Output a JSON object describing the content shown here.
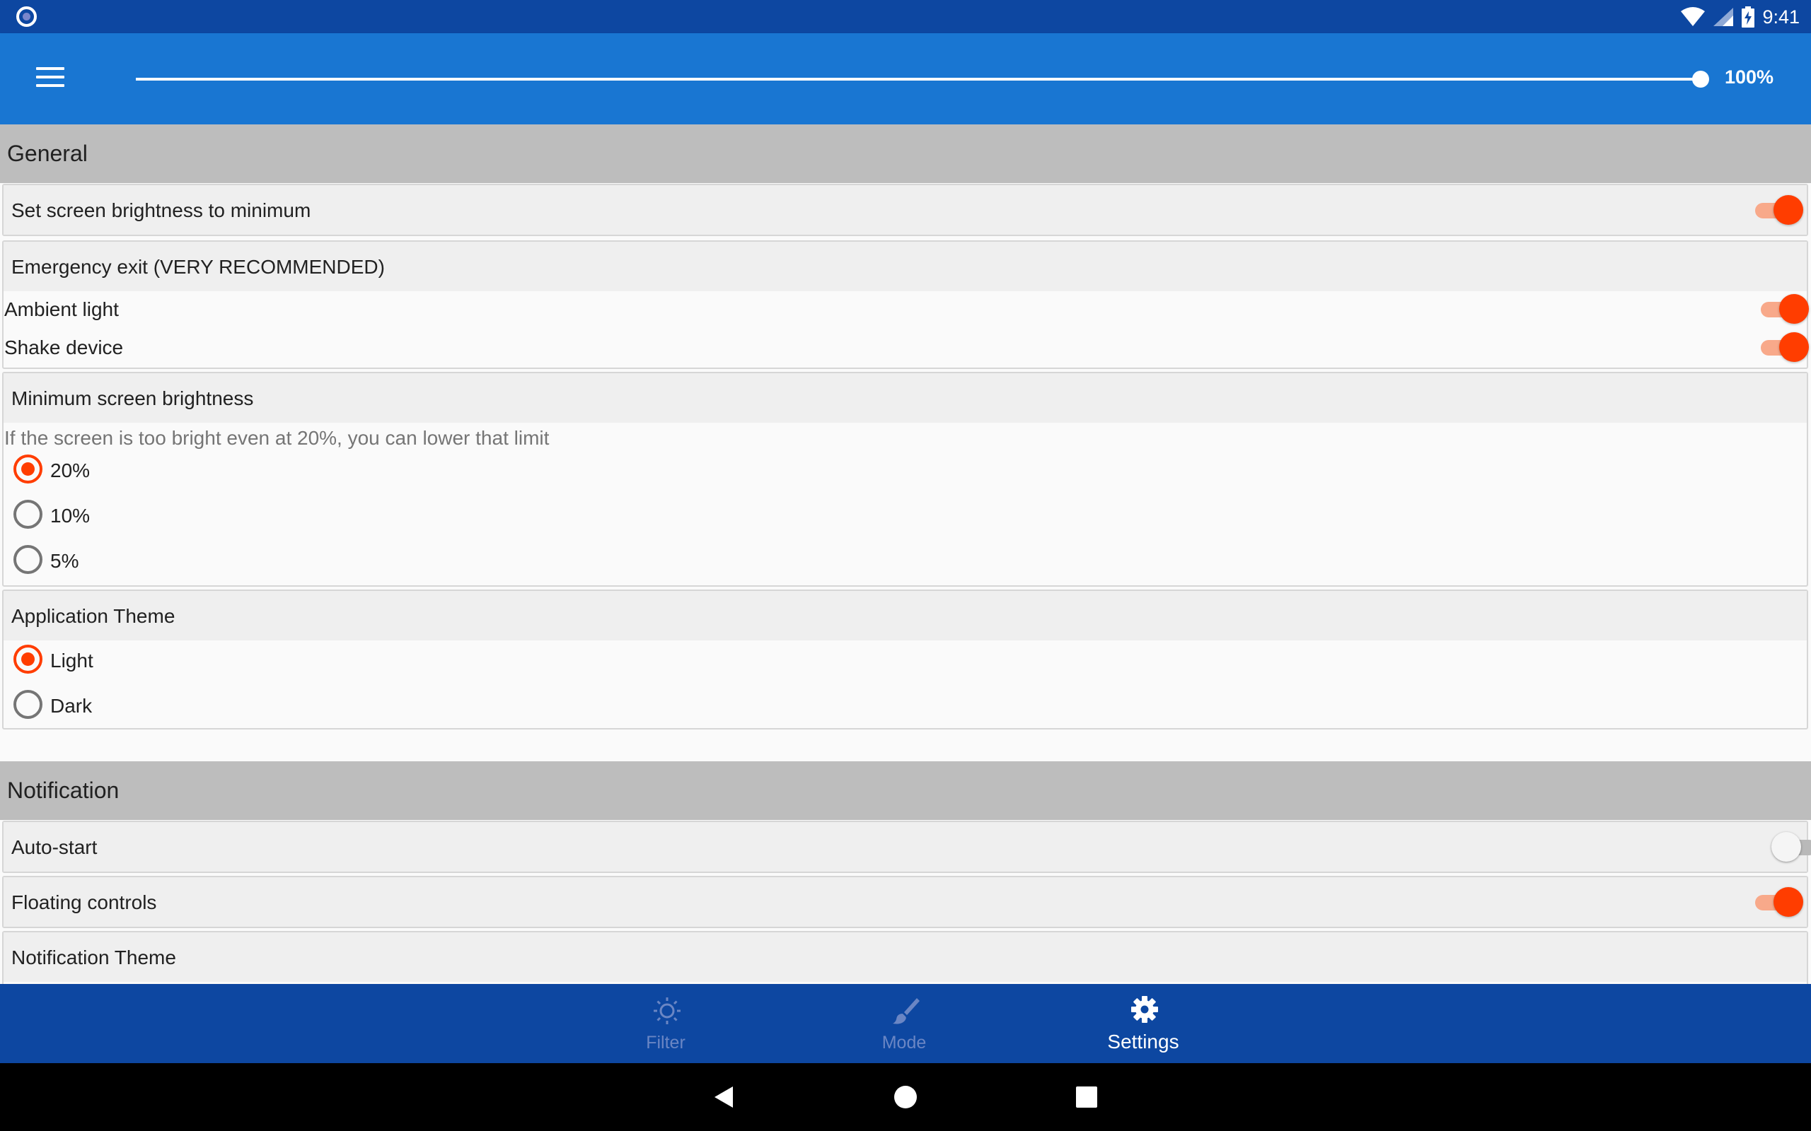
{
  "status_bar": {
    "time": "9:41"
  },
  "app_bar": {
    "slider_value_label": "100%",
    "slider_level": 1.0
  },
  "sections": {
    "general": {
      "title": "General"
    },
    "notification": {
      "title": "Notification"
    }
  },
  "settings": {
    "min_brightness": {
      "label": "Set screen brightness to minimum",
      "enabled": true
    },
    "emergency_exit": {
      "title": "Emergency exit (VERY RECOMMENDED)",
      "ambient_light": {
        "label": "Ambient light",
        "enabled": true
      },
      "shake_device": {
        "label": "Shake device",
        "enabled": true
      }
    },
    "minimum_screen_brightness": {
      "title": "Minimum screen brightness",
      "hint": "If the screen is too bright even at 20%, you can lower that limit",
      "options": [
        "20%",
        "10%",
        "5%"
      ],
      "selected": "20%"
    },
    "application_theme": {
      "title": "Application Theme",
      "options": [
        "Light",
        "Dark"
      ],
      "selected": "Light"
    },
    "auto_start": {
      "label": "Auto-start",
      "enabled": false
    },
    "floating_controls": {
      "label": "Floating controls",
      "enabled": true
    },
    "notification_theme": {
      "title": "Notification Theme"
    }
  },
  "bottom_nav": {
    "items": [
      {
        "label": "Filter",
        "icon": "brightness-icon",
        "active": false
      },
      {
        "label": "Mode",
        "icon": "brush-icon",
        "active": false
      },
      {
        "label": "Settings",
        "icon": "gear-icon",
        "active": true
      }
    ]
  },
  "colors": {
    "status_bar": "#0d47a1",
    "app_bar": "#1976d2",
    "accent": "#ff3d00",
    "section_header": "#bdbdbd",
    "bottom_nav": "#0d47a1"
  }
}
